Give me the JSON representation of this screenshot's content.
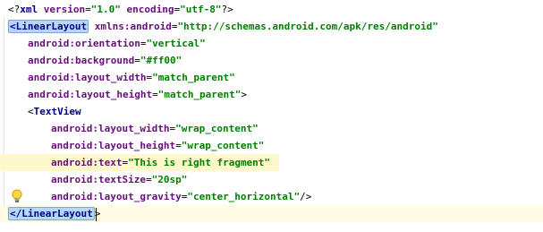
{
  "editor": {
    "lines": [
      {
        "indent": 1,
        "parts": [
          {
            "k": "punct",
            "t": "<?"
          },
          {
            "k": "tag",
            "t": "xml"
          },
          {
            "k": "plain",
            "t": " "
          },
          {
            "k": "attr",
            "t": "version"
          },
          {
            "k": "punct",
            "t": "="
          },
          {
            "k": "val",
            "t": "\"1.0\""
          },
          {
            "k": "plain",
            "t": " "
          },
          {
            "k": "attr",
            "t": "encoding"
          },
          {
            "k": "punct",
            "t": "="
          },
          {
            "k": "val",
            "t": "\"utf-8\""
          },
          {
            "k": "punct",
            "t": "?>"
          }
        ]
      },
      {
        "indent": 1,
        "parts": [
          {
            "k": "tagmatch",
            "t": "<LinearLayout"
          },
          {
            "k": "plain",
            "t": " "
          },
          {
            "k": "attr",
            "t": "xmlns:android"
          },
          {
            "k": "punct",
            "t": "="
          },
          {
            "k": "val",
            "t": "\"http://schemas.android.com/apk/res/android\""
          }
        ]
      },
      {
        "indent": 2,
        "parts": [
          {
            "k": "ns",
            "t": "android:orientation"
          },
          {
            "k": "punct",
            "t": "="
          },
          {
            "k": "val",
            "t": "\"vertical\""
          }
        ]
      },
      {
        "indent": 2,
        "parts": [
          {
            "k": "ns",
            "t": "android:background"
          },
          {
            "k": "punct",
            "t": "="
          },
          {
            "k": "val",
            "t": "\"#ff00\""
          }
        ]
      },
      {
        "indent": 2,
        "parts": [
          {
            "k": "ns",
            "t": "android:layout_width"
          },
          {
            "k": "punct",
            "t": "="
          },
          {
            "k": "val",
            "t": "\"match_parent\""
          }
        ]
      },
      {
        "indent": 2,
        "parts": [
          {
            "k": "ns",
            "t": "android:layout_height"
          },
          {
            "k": "punct",
            "t": "="
          },
          {
            "k": "val",
            "t": "\"match_parent\""
          },
          {
            "k": "punct",
            "t": ">"
          }
        ]
      },
      {
        "indent": 2,
        "parts": [
          {
            "k": "punct",
            "t": "<"
          },
          {
            "k": "tag",
            "t": "TextView"
          }
        ]
      },
      {
        "indent": 3,
        "parts": [
          {
            "k": "ns",
            "t": "android:layout_width"
          },
          {
            "k": "punct",
            "t": "="
          },
          {
            "k": "val",
            "t": "\"wrap_content\""
          }
        ]
      },
      {
        "indent": 3,
        "parts": [
          {
            "k": "ns",
            "t": "android:layout_height"
          },
          {
            "k": "punct",
            "t": "="
          },
          {
            "k": "val",
            "t": "\"wrap_content\""
          }
        ]
      },
      {
        "indent": 3,
        "highlight": true,
        "parts": [
          {
            "k": "ns",
            "t": "android:text"
          },
          {
            "k": "punct",
            "t": "="
          },
          {
            "k": "val",
            "t": "\"This is right fragment\""
          }
        ]
      },
      {
        "indent": 3,
        "parts": [
          {
            "k": "ns",
            "t": "android:textSize"
          },
          {
            "k": "punct",
            "t": "="
          },
          {
            "k": "val",
            "t": "\"20sp\""
          }
        ]
      },
      {
        "indent": 3,
        "parts": [
          {
            "k": "ns",
            "t": "android:layout_gravity"
          },
          {
            "k": "punct",
            "t": "="
          },
          {
            "k": "val",
            "t": "\"center_horizontal\""
          },
          {
            "k": "punct",
            "t": "/>"
          }
        ]
      },
      {
        "indent": 1,
        "caret": true,
        "parts": [
          {
            "k": "tagmatch",
            "t": "</LinearLayout"
          },
          {
            "k": "punct",
            "t": ">"
          }
        ]
      }
    ]
  },
  "icons": {
    "intention_bulb": "lightbulb-icon"
  }
}
